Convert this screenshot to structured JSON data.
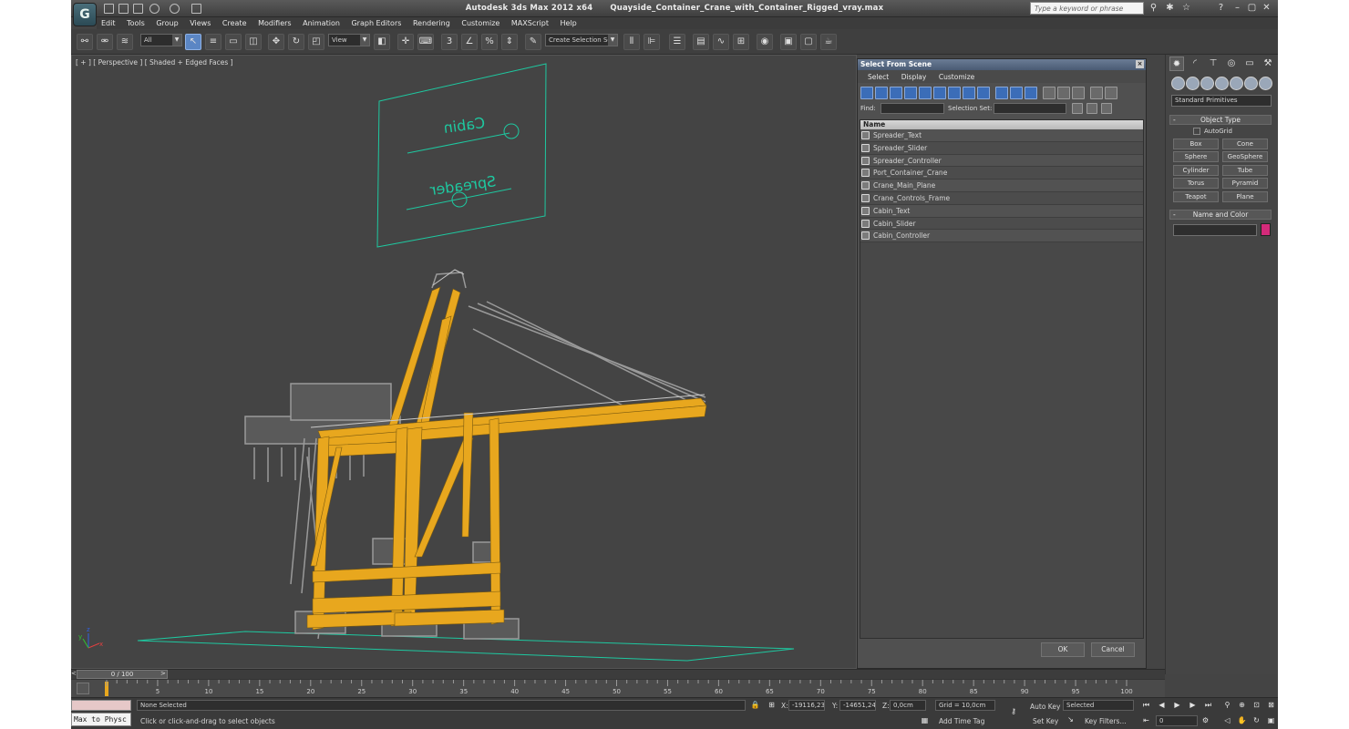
{
  "window": {
    "app_title": "Autodesk 3ds Max  2012 x64",
    "file_name": "Quayside_Container_Crane_with_Container_Rigged_vray.max",
    "search_placeholder": "Type a keyword or phrase"
  },
  "menu": [
    "Edit",
    "Tools",
    "Group",
    "Views",
    "Create",
    "Modifiers",
    "Animation",
    "Graph Editors",
    "Rendering",
    "Customize",
    "MAXScript",
    "Help"
  ],
  "toolbar": {
    "selection_filter": "All",
    "reference_coord": "View",
    "snap_label": "3",
    "named_selection_set": "Create Selection Se"
  },
  "viewport": {
    "label": "[ + ] [ Perspective ] [ Shaded + Edged Faces ]",
    "scene_text_1": "Cabin",
    "scene_text_2": "Spreader",
    "axis_x": "x",
    "axis_y": "y",
    "axis_z": "z"
  },
  "dialog": {
    "title": "Select From Scene",
    "close_glyph": "×",
    "menu": [
      "Select",
      "Display",
      "Customize"
    ],
    "find_label": "Find:",
    "selection_set_label": "Selection Set:",
    "column_header": "Name",
    "objects": [
      "Spreader_Text",
      "Spreader_Slider",
      "Spreader_Controller",
      "Port_Container_Crane",
      "Crane_Main_Plane",
      "Crane_Controls_Frame",
      "Cabin_Text",
      "Cabin_Slider",
      "Cabin_Controller"
    ],
    "ok_label": "OK",
    "cancel_label": "Cancel"
  },
  "command_panel": {
    "category": "Standard Primitives",
    "object_type_title": "Object Type",
    "autogrid_label": "AutoGrid",
    "primitives": [
      "Box",
      "Cone",
      "Sphere",
      "GeoSphere",
      "Cylinder",
      "Tube",
      "Torus",
      "Pyramid",
      "Teapot",
      "Plane"
    ],
    "name_color_title": "Name and Color",
    "object_color": "#d42a7a",
    "rollout_collapse": "-"
  },
  "timeline": {
    "current": "0 / 100",
    "ticks": [
      "5",
      "10",
      "15",
      "20",
      "25",
      "30",
      "35",
      "40",
      "45",
      "50",
      "55",
      "60",
      "65",
      "70",
      "75",
      "80",
      "85",
      "90",
      "95",
      "100"
    ]
  },
  "status": {
    "selection": "None Selected",
    "prompt": "Click or click-and-drag to select objects",
    "maxscript_text": "Max to Physc",
    "x_label": "X:",
    "x_value": "-19116,23",
    "y_label": "Y:",
    "y_value": "-14651,24",
    "z_label": "Z:",
    "z_value": "0,0cm",
    "grid": "Grid = 10,0cm",
    "auto_key": "Auto Key",
    "set_key": "Set Key",
    "key_mode": "Selected",
    "key_filters": "Key Filters...",
    "add_time_tag": "Add Time Tag",
    "frame": "0"
  },
  "colors": {
    "crane_yellow": "#e8a71e",
    "wire_teal": "#1ec8a0",
    "wire_gray": "#9a9a9a",
    "viewport_bg": "#444444"
  }
}
